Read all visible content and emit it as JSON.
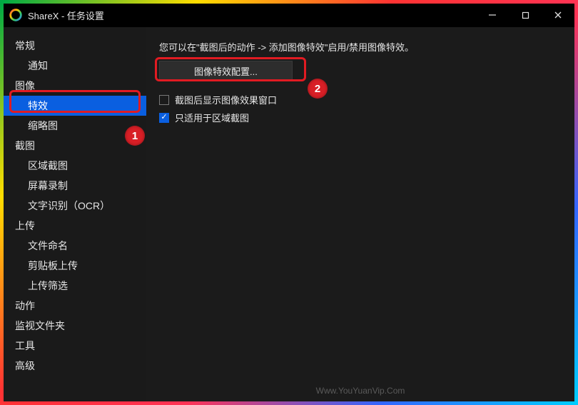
{
  "window": {
    "title": "ShareX - 任务设置"
  },
  "sidebar": {
    "items": [
      {
        "label": "常规",
        "level": 0
      },
      {
        "label": "通知",
        "level": 1
      },
      {
        "label": "图像",
        "level": 0
      },
      {
        "label": "特效",
        "level": 1,
        "selected": true
      },
      {
        "label": "缩略图",
        "level": 1
      },
      {
        "label": "截图",
        "level": 0
      },
      {
        "label": "区域截图",
        "level": 1
      },
      {
        "label": "屏幕录制",
        "level": 1
      },
      {
        "label": "文字识别（OCR）",
        "level": 1
      },
      {
        "label": "上传",
        "level": 0
      },
      {
        "label": "文件命名",
        "level": 1
      },
      {
        "label": "剪贴板上传",
        "level": 1
      },
      {
        "label": "上传筛选",
        "level": 1
      },
      {
        "label": "动作",
        "level": 0
      },
      {
        "label": "监视文件夹",
        "level": 0
      },
      {
        "label": "工具",
        "level": 0
      },
      {
        "label": "高级",
        "level": 0
      }
    ]
  },
  "content": {
    "instruction": "您可以在\"截图后的动作 -> 添加图像特效\"启用/禁用图像特效。",
    "config_button": "图像特效配置...",
    "checkbox_show_window": {
      "label": "截图后显示图像效果窗口",
      "checked": false
    },
    "checkbox_region_only": {
      "label": "只适用于区域截图",
      "checked": true
    }
  },
  "callouts": {
    "one": "1",
    "two": "2"
  },
  "watermark": "Www.YouYuanVip.Com"
}
